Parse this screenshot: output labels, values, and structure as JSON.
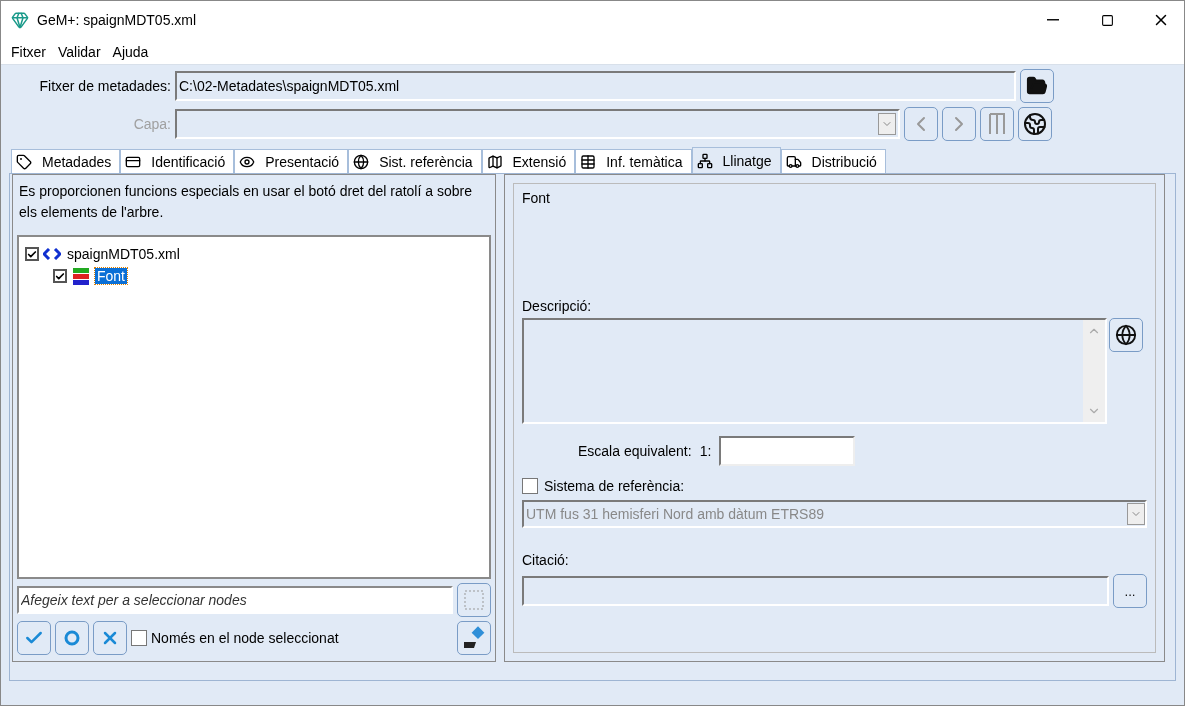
{
  "window": {
    "title": "GeM+: spaignMDT05.xml"
  },
  "menu": [
    "Fitxer",
    "Validar",
    "Ajuda"
  ],
  "file_field": {
    "label": "Fitxer de metadades:",
    "value": "C:\\02-Metadates\\spaignMDT05.xml"
  },
  "layer_field": {
    "label": "Capa:",
    "disabled": true
  },
  "tabs": [
    {
      "label": "Metadades",
      "selected": false
    },
    {
      "label": "Identificació",
      "selected": false
    },
    {
      "label": "Presentació",
      "selected": false
    },
    {
      "label": "Sist. referència",
      "selected": false
    },
    {
      "label": "Extensió",
      "selected": false
    },
    {
      "label": "Inf. temàtica",
      "selected": false
    },
    {
      "label": "Llinatge",
      "selected": true
    },
    {
      "label": "Distribució",
      "selected": false
    }
  ],
  "left_panel": {
    "hint": "Es proporcionen funcions especials en usar el botó dret del ratolí a sobre els elements de l'arbre.",
    "tree": [
      {
        "label": "spaignMDT05.xml",
        "kind": "file",
        "checked": true,
        "selected": false,
        "children": [
          {
            "label": "Font",
            "kind": "source",
            "checked": true,
            "selected": true
          }
        ]
      }
    ],
    "search": {
      "placeholder": "Afegeix text per a seleccionar nodes"
    },
    "only_selected": {
      "label": "Només en el node seleccionat",
      "checked": false
    }
  },
  "right_panel": {
    "group_title": "Font",
    "description_label": "Descripció:",
    "scale": {
      "label": "Escala equivalent:",
      "prefix": "1:"
    },
    "reference_system": {
      "label": "Sistema de referència:",
      "checked": false,
      "value": "UTM fus 31 hemisferi Nord amb dàtum ETRS89"
    },
    "citation_label": "Citació:",
    "browse_button": "..."
  }
}
